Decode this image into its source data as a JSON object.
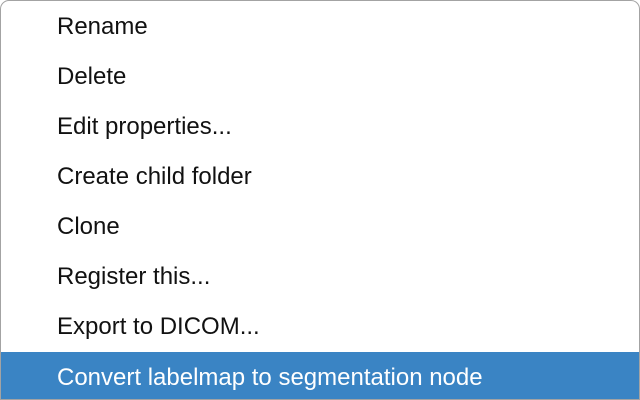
{
  "menu": {
    "items": [
      {
        "label": "Rename"
      },
      {
        "label": "Delete"
      },
      {
        "label": "Edit properties..."
      },
      {
        "label": "Create child folder"
      },
      {
        "label": "Clone"
      },
      {
        "label": "Register this..."
      },
      {
        "label": "Export to DICOM..."
      },
      {
        "label": "Convert labelmap to segmentation node",
        "highlighted": true
      }
    ],
    "highlight_color": "#3a84c4",
    "text_color": "#111111"
  }
}
